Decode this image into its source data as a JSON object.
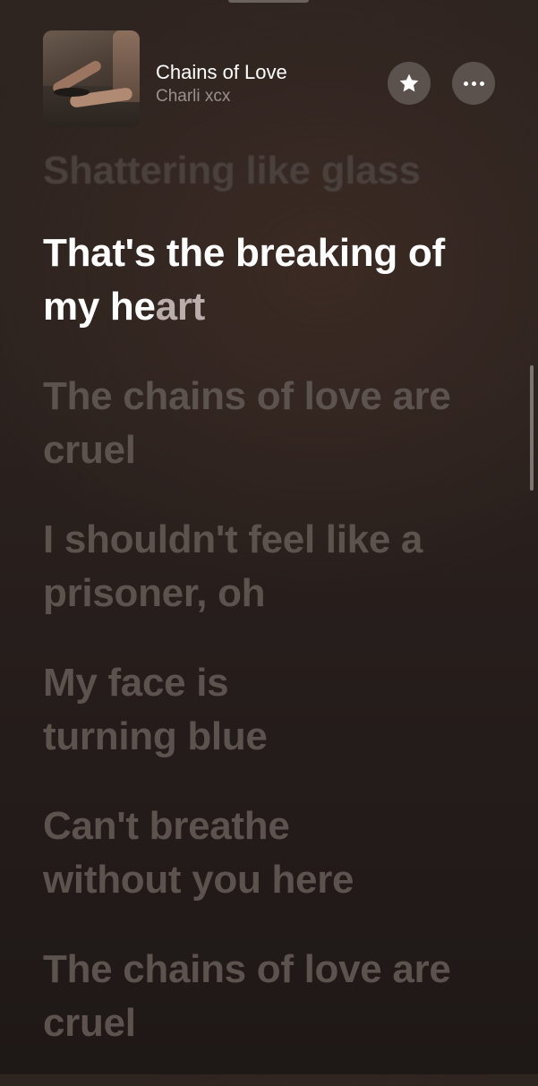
{
  "now_playing": {
    "title": "Chains of Love",
    "artist": "Charli xcx"
  },
  "icons": {
    "favorite": "star-icon",
    "more": "more-horizontal-icon",
    "artwork": "album-artwork"
  },
  "lyrics": {
    "previous_line": "Shattering like glass",
    "current_line_sung": "That's the breaking of my he",
    "current_line_unsung": "art",
    "upcoming": [
      "The chains of love are cruel",
      "I shouldn't feel like a prisoner, oh",
      "My face is turning blue",
      "Can't breathe without you here",
      "The chains of love are cruel"
    ]
  },
  "colors": {
    "active_lyric": "#ffffff",
    "inactive_lyric": "#5c524e",
    "button_bg": "#5b524e",
    "artist_text": "#9a918c"
  }
}
